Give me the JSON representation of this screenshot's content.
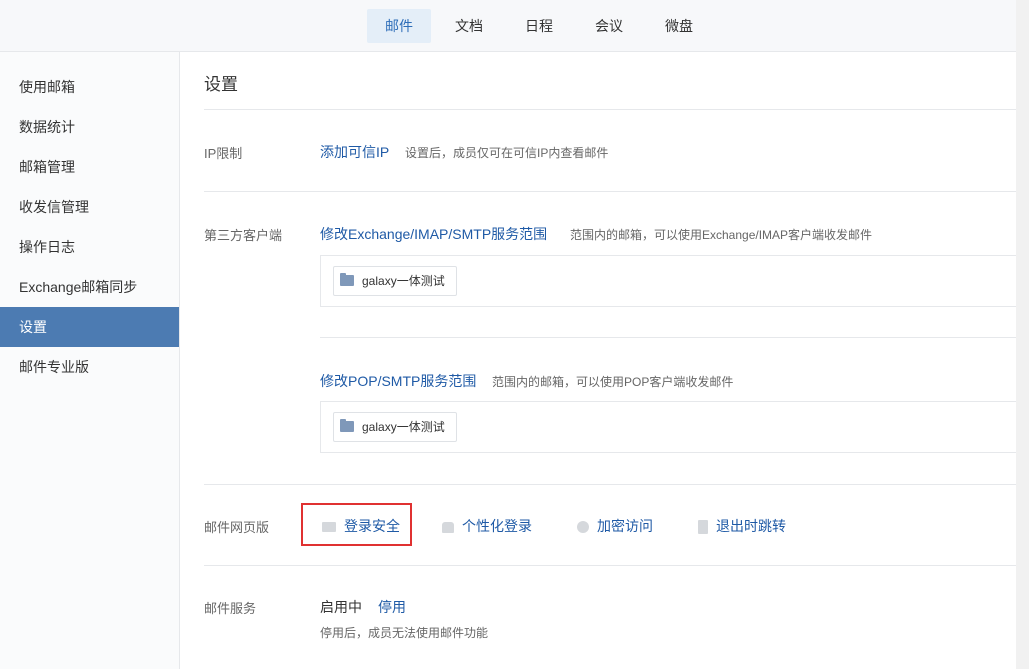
{
  "top_tabs": [
    {
      "label": "邮件",
      "active": true
    },
    {
      "label": "文档",
      "active": false
    },
    {
      "label": "日程",
      "active": false
    },
    {
      "label": "会议",
      "active": false
    },
    {
      "label": "微盘",
      "active": false
    }
  ],
  "sidebar": {
    "items": [
      {
        "label": "使用邮箱"
      },
      {
        "label": "数据统计"
      },
      {
        "label": "邮箱管理"
      },
      {
        "label": "收发信管理"
      },
      {
        "label": "操作日志"
      },
      {
        "label": "Exchange邮箱同步"
      },
      {
        "label": "设置",
        "active": true
      },
      {
        "label": "邮件专业版"
      }
    ]
  },
  "main": {
    "title": "设置",
    "ip_limit": {
      "label": "IP限制",
      "link": "添加可信IP",
      "desc": "设置后，成员仅可在可信IP内查看邮件"
    },
    "third_party": {
      "label": "第三方客户端",
      "exchange": {
        "link": "修改Exchange/IMAP/SMTP服务范围",
        "desc": "范围内的邮箱，可以使用Exchange/IMAP客户端收发邮件",
        "chip": "galaxy一体测试"
      },
      "pop": {
        "link": "修改POP/SMTP服务范围",
        "desc": "范围内的邮箱，可以使用POP客户端收发邮件",
        "chip": "galaxy一体测试"
      }
    },
    "web": {
      "label": "邮件网页版",
      "items": [
        {
          "label": "登录安全",
          "icon": "monitor-icon"
        },
        {
          "label": "个性化登录",
          "icon": "shirt-icon"
        },
        {
          "label": "加密访问",
          "icon": "shield-icon"
        },
        {
          "label": "退出时跳转",
          "icon": "door-icon"
        }
      ]
    },
    "service": {
      "label": "邮件服务",
      "status": "启用中",
      "action": "停用",
      "note": "停用后，成员无法使用邮件功能"
    }
  },
  "colors": {
    "accent": "#4c7bb2",
    "link": "#1f5aa6",
    "highlight": "#e03131"
  }
}
